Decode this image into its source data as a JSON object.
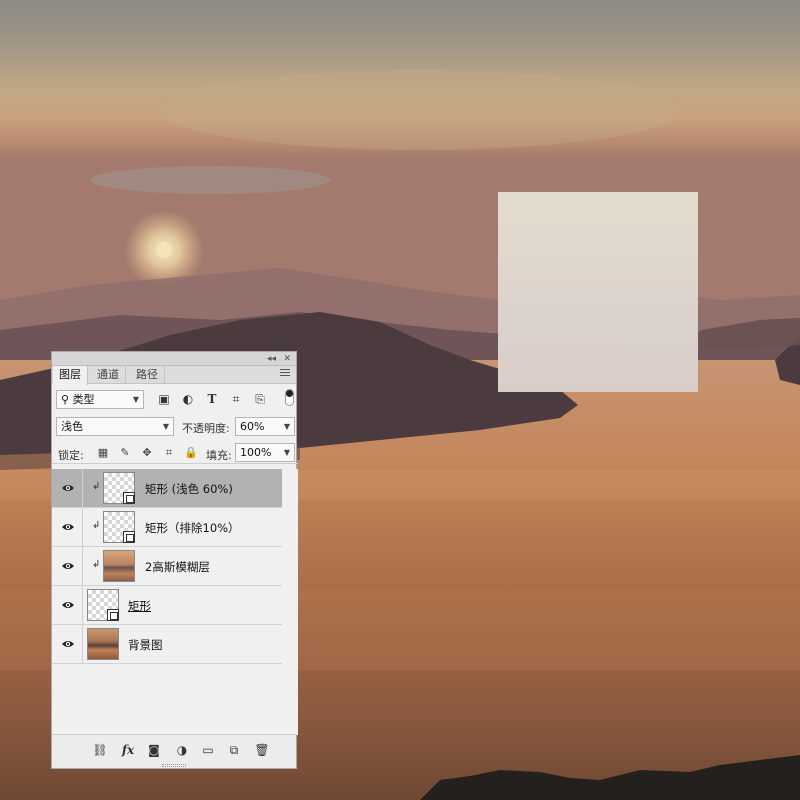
{
  "document": {
    "description_colors": {
      "sky_top": "#8f8a86",
      "sun": "#f3e5b6",
      "water": "#b8774f",
      "frost": "#dfd6cc"
    }
  },
  "layers_panel": {
    "tabs": [
      {
        "label": "图层",
        "active": true
      },
      {
        "label": "通道",
        "active": false
      },
      {
        "label": "路径",
        "active": false
      }
    ],
    "filter": {
      "kind_label": "类型",
      "icons": [
        "image-filter-icon",
        "adjustment-filter-icon",
        "type-filter-icon",
        "shape-filter-icon",
        "smart-object-filter-icon"
      ]
    },
    "blend_mode": "浅色",
    "opacity_label": "不透明度:",
    "opacity_value": "60%",
    "lock_label": "锁定:",
    "fill_label": "填充:",
    "fill_value": "100%",
    "layers": [
      {
        "name": "矩形 (浅色 60%)",
        "visible": true,
        "clipped": true,
        "thumb": "shape",
        "selected": true
      },
      {
        "name": "矩形（排除10%）",
        "visible": true,
        "clipped": true,
        "thumb": "shape",
        "selected": false
      },
      {
        "name": "2高斯模糊层",
        "visible": true,
        "clipped": true,
        "thumb": "blur",
        "selected": false
      },
      {
        "name": "矩形",
        "visible": true,
        "clipped": false,
        "thumb": "shape",
        "selected": false,
        "underline": true
      },
      {
        "name": "背景图",
        "visible": true,
        "clipped": false,
        "thumb": "photo",
        "selected": false
      }
    ]
  }
}
